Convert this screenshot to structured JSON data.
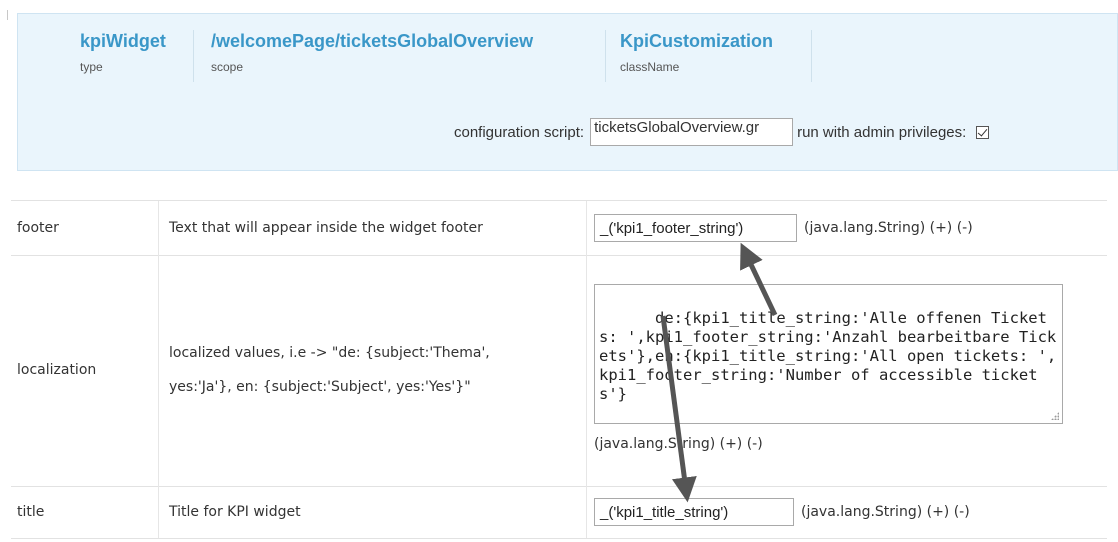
{
  "header": {
    "type": {
      "value": "kpiWidget",
      "label": "type"
    },
    "scope": {
      "value": "/welcomePage/ticketsGlobalOverview",
      "label": "scope"
    },
    "className": {
      "value": "KpiCustomization",
      "label": "className"
    },
    "config_script_label": "configuration script:",
    "config_script_value": "ticketsGlobalOverview.gr",
    "admin_label": "run with admin privileges:",
    "admin_checked": true
  },
  "properties": [
    {
      "name": "footer",
      "description": "Text that will appear inside the widget footer",
      "value": "_('kpi1_footer_string')",
      "type_hint": "(java.lang.String) (+) (-)"
    },
    {
      "name": "localization",
      "description_line1": "localized values, i.e -> \"de: {subject:'Thema',",
      "description_line2": "yes:'Ja'}, en: {subject:'Subject', yes:'Yes'}\"",
      "value": "de:{kpi1_title_string:'Alle offenen Tickets: ',kpi1_footer_string:'Anzahl bearbeitbare Tickets'},en:{kpi1_title_string:'All open tickets: ',kpi1_footer_string:'Number of accessible tickets'}",
      "type_hint": "(java.lang.String) (+) (-)"
    },
    {
      "name": "title",
      "description": "Title for KPI widget",
      "value": "_('kpi1_title_string')",
      "type_hint": "(java.lang.String) (+) (-)"
    }
  ],
  "colors": {
    "header_bg": "#eaf5fc",
    "header_value": "#3a97c8",
    "arrow": "#555555"
  },
  "icons": [
    "checkbox-checked-icon",
    "resize-grip-icon",
    "arrow-annotation"
  ]
}
